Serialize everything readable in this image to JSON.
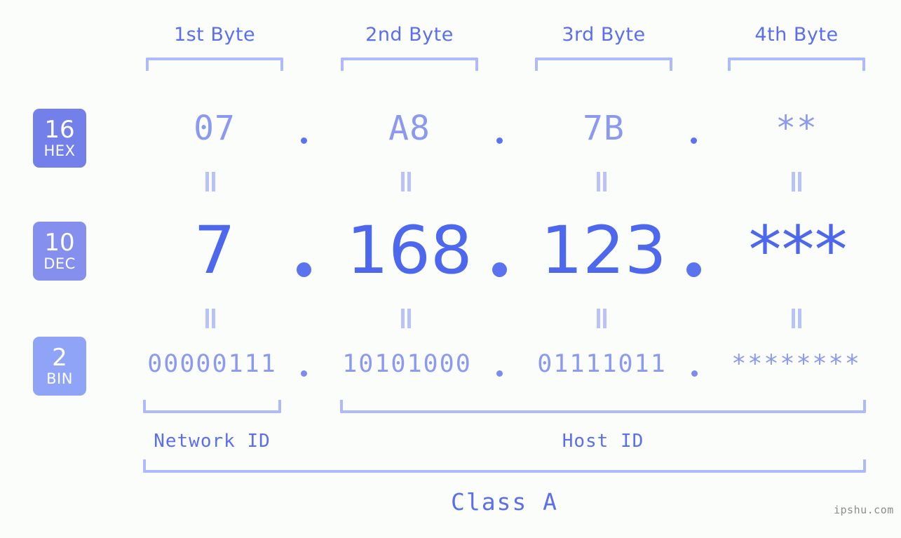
{
  "background_color": "#fafdfa",
  "accent_colors": {
    "dec_value": "#4d67ed",
    "hex_bin_value": "#8b99f0",
    "bracket": "#aebaf9",
    "label": "#5b6ef0",
    "badge_hex": "#7480ea",
    "badge_dec": "#8590ee",
    "badge_bin": "#8fa4f7",
    "watermark": "#8c8c8c"
  },
  "byte_headers": [
    {
      "label": "1st Byte"
    },
    {
      "label": "2nd Byte"
    },
    {
      "label": "3rd Byte"
    },
    {
      "label": "4th Byte"
    }
  ],
  "bases": [
    {
      "number": "16",
      "abbr": "HEX"
    },
    {
      "number": "10",
      "abbr": "DEC"
    },
    {
      "number": "2",
      "abbr": "BIN"
    }
  ],
  "rows": {
    "hex": {
      "base_number": "16",
      "base_abbr": "HEX",
      "values": [
        "07",
        "A8",
        "7B",
        "**"
      ],
      "separator": "."
    },
    "dec": {
      "base_number": "10",
      "base_abbr": "DEC",
      "values": [
        "7",
        "168",
        "123",
        "***"
      ],
      "separator": "."
    },
    "bin": {
      "base_number": "2",
      "base_abbr": "BIN",
      "values": [
        "00000111",
        "10101000",
        "01111011",
        "********"
      ],
      "separator": "."
    }
  },
  "equals_symbol": "=",
  "regions": [
    {
      "label": "Network ID"
    },
    {
      "label": "Host ID"
    }
  ],
  "class_label": "Class A",
  "watermark": "ipshu.com"
}
